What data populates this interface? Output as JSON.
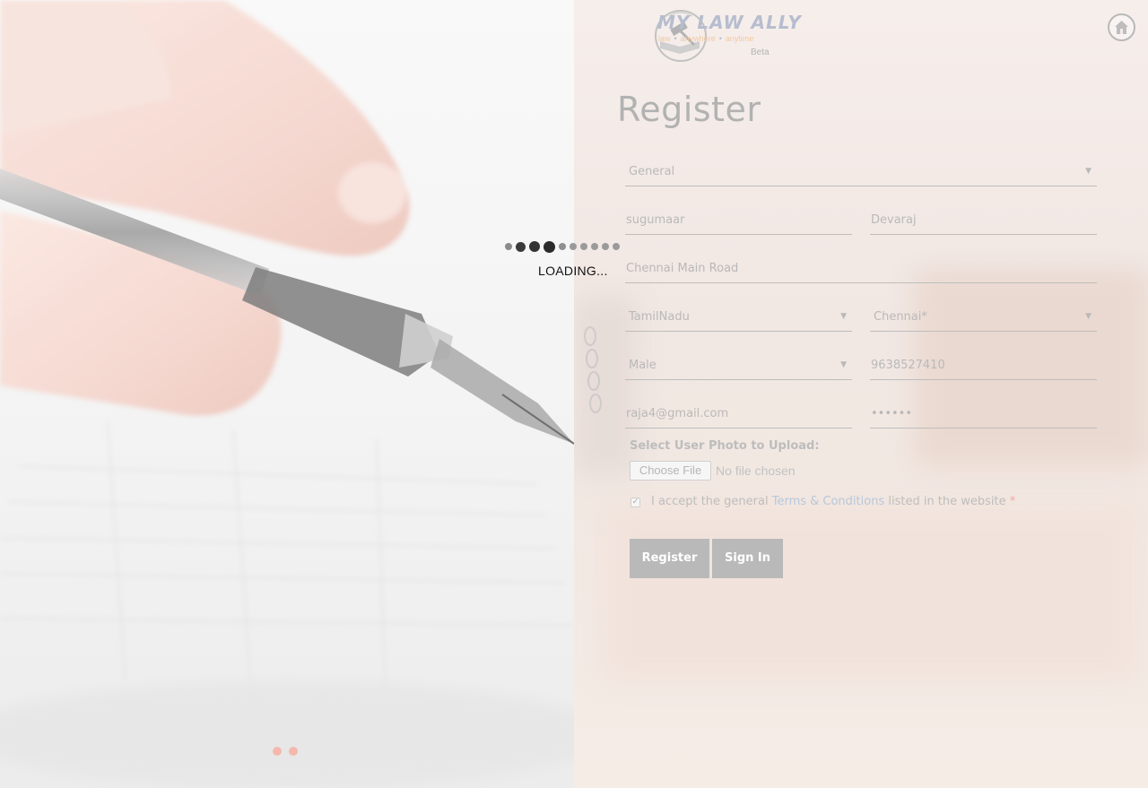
{
  "brand": {
    "name": "MY LAW ALLY",
    "tagline": [
      "law",
      "anywhere",
      "anytime"
    ],
    "badge": "Beta"
  },
  "form": {
    "title": "Register",
    "user_type": {
      "value": "General"
    },
    "first_name": {
      "value": "sugumaar"
    },
    "last_name": {
      "value": "Devaraj"
    },
    "address": {
      "value": "Chennai Main Road"
    },
    "state": {
      "value": "TamilNadu"
    },
    "city": {
      "value": "Chennai*"
    },
    "gender": {
      "value": "Male"
    },
    "phone": {
      "value": "9638527410"
    },
    "email": {
      "value": "raja4@gmail.com"
    },
    "password": {
      "value": "••••••"
    },
    "upload_label": "Select User Photo to Upload:",
    "choose_file_label": "Choose File",
    "no_file_text": "No file chosen",
    "terms": {
      "checked": true,
      "prefix": "I accept the general ",
      "link": "Terms & Conditions",
      "suffix": " listed in the website ",
      "required_mark": "*"
    },
    "register_label": "Register",
    "signin_label": "Sign In"
  },
  "loading": {
    "text": "LOADING..."
  },
  "carousel": {
    "slide_count": 2
  },
  "colors": {
    "button_bg": "#b9b9b9",
    "link": "#b7c7dc",
    "required": "#f0a7a7",
    "dot_accent": "#f4b8ae"
  },
  "icons": {
    "home": "home-icon",
    "logo": "gavel-book-emblem-icon",
    "dropdown": "caret-down-icon"
  }
}
